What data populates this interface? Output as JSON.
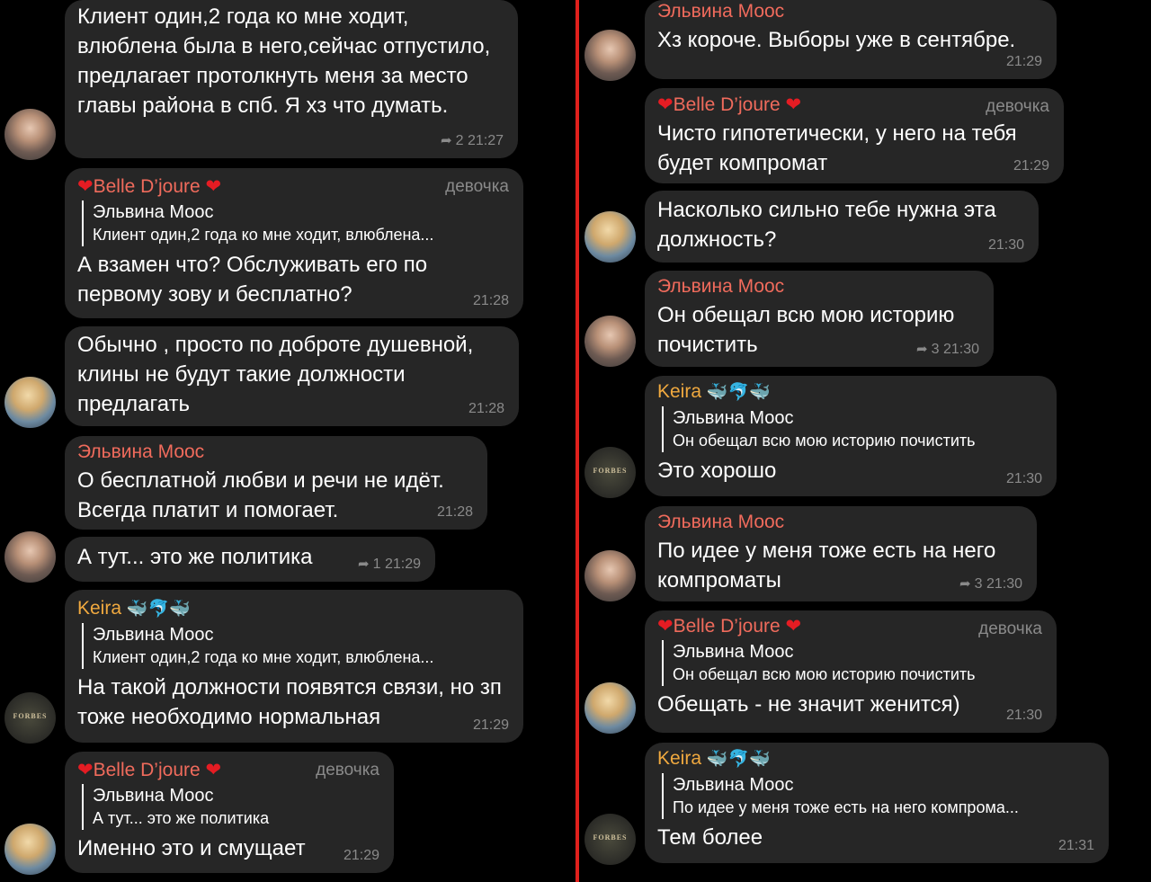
{
  "left": {
    "messages": [
      {
        "text": "Клиент один,2 года ко мне ходит, влюблена была в него,сейчас отпустило, предлагает протолкнуть меня за место главы района в спб. Я хз что думать.",
        "replies": "2",
        "time": "21:27"
      },
      {
        "sender": "Belle D’joure",
        "role": "девочка",
        "reply_name": "Эльвина Моос",
        "reply_text": "Клиент один,2 года ко мне ходит, влюблена...",
        "text": "А взамен что? Обслуживать его по первому зову и бесплатно?",
        "time": "21:28"
      },
      {
        "text": "Обычно , просто по доброте душевной, клины не будут такие должности предлагать",
        "time": "21:28"
      },
      {
        "sender": "Эльвина Моос",
        "text": "О бесплатной любви и речи не идёт. Всегда платит и помогает.",
        "time": "21:28"
      },
      {
        "text": "А тут... это же политика",
        "replies": "1",
        "time": "21:29"
      },
      {
        "sender": "Keira",
        "sender_emoji": "🐳🐬🐳",
        "reply_name": "Эльвина Моос",
        "reply_text": "Клиент один,2 года ко мне ходит, влюблена...",
        "text": "На такой должности появятся связи, но зп тоже необходимо нормальная",
        "time": "21:29"
      },
      {
        "sender": "Belle D’joure",
        "role": "девочка",
        "reply_name": "Эльвина Моос",
        "reply_text": "А тут... это же политика",
        "text": "Именно это и смущает",
        "time": "21:29"
      }
    ]
  },
  "right": {
    "messages": [
      {
        "sender": "Эльвина Моос",
        "text": "Хз короче. Выборы уже в сентябре.",
        "time": "21:29"
      },
      {
        "sender": "Belle D’joure",
        "role": "девочка",
        "text": "Чисто гипотетически, у него на тебя будет компромат",
        "time": "21:29"
      },
      {
        "text": "Насколько сильно тебе нужна эта должность?",
        "time": "21:30"
      },
      {
        "sender": "Эльвина Моос",
        "text": "Он обещал всю мою историю почистить",
        "replies": "3",
        "time": "21:30"
      },
      {
        "sender": "Keira",
        "sender_emoji": "🐳🐬🐳",
        "reply_name": "Эльвина Моос",
        "reply_text": "Он обещал всю мою историю почистить",
        "text": "Это хорошо",
        "time": "21:30"
      },
      {
        "sender": "Эльвина Моос",
        "text": "По идее у меня тоже есть на него компроматы",
        "replies": "3",
        "time": "21:30"
      },
      {
        "sender": "Belle D’joure",
        "role": "девочка",
        "reply_name": "Эльвина Моос",
        "reply_text": "Он обещал всю мою историю почистить",
        "text": "Обещать - не значит женится)",
        "time": "21:30"
      },
      {
        "sender": "Keira",
        "sender_emoji": "🐳🐬🐳",
        "reply_name": "Эльвина Моос",
        "reply_text": "По идее у меня тоже есть на него компрома...",
        "text": "Тем более",
        "time": "21:31"
      }
    ]
  },
  "icons": {
    "heart": "❤",
    "reply_arrow": "➦",
    "avatar_logo": "FORBES"
  },
  "colors": {
    "bubble": "#262626",
    "name_red": "#f06b5c",
    "name_orange": "#f0a93f",
    "divider": "#e0201c",
    "meta": "#8a8a8a"
  }
}
